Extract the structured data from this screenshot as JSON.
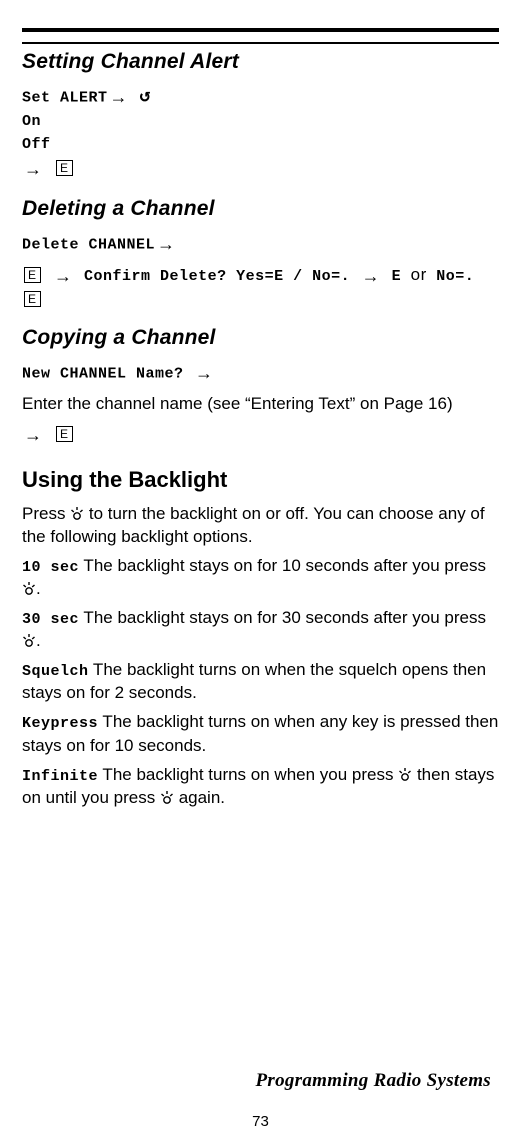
{
  "rules": {},
  "setting_channel_alert": {
    "title": "Setting Channel Alert",
    "line1_label": "Set ALERT",
    "line2": "On",
    "line3": "Off"
  },
  "deleting_channel": {
    "title": "Deleting a Channel",
    "line1_label": "Delete CHANNEL",
    "confirm_text": "Confirm Delete? Yes=E / No=.",
    "yes_label": "E",
    "or_word": "or",
    "no_label": "No=."
  },
  "copying_channel": {
    "title": "Copying a Channel",
    "line1": "New CHANNEL Name?",
    "body": "Enter the channel name (see “Entering Text” on Page 16)"
  },
  "backlight": {
    "title": "Using the Backlight",
    "intro_a": "Press ",
    "intro_b": " to turn the backlight on or off. You can choose any of the following backlight options.",
    "opts": [
      {
        "label": "10 sec",
        "text_a": " The backlight stays on for 10 seconds after you press ",
        "text_b": "."
      },
      {
        "label": "30 sec",
        "text_a": " The backlight stays on for 30 seconds after you press ",
        "text_b": "."
      },
      {
        "label": "Squelch",
        "text_a": " The backlight turns on when the squelch opens then stays on for 2 seconds.",
        "text_b": ""
      },
      {
        "label": "Keypress",
        "text_a": " The backlight turns on when any key is pressed then stays on for 10 seconds.",
        "text_b": ""
      }
    ],
    "infinite_label": "Infinite",
    "infinite_a": " The backlight turns on when you press ",
    "infinite_b": " then stays on until you press ",
    "infinite_c": " again."
  },
  "footer": {
    "section": "Programming Radio Systems",
    "page": "73"
  },
  "glyphs": {
    "arrow": "→",
    "reload": "↺",
    "ebox": "E"
  }
}
